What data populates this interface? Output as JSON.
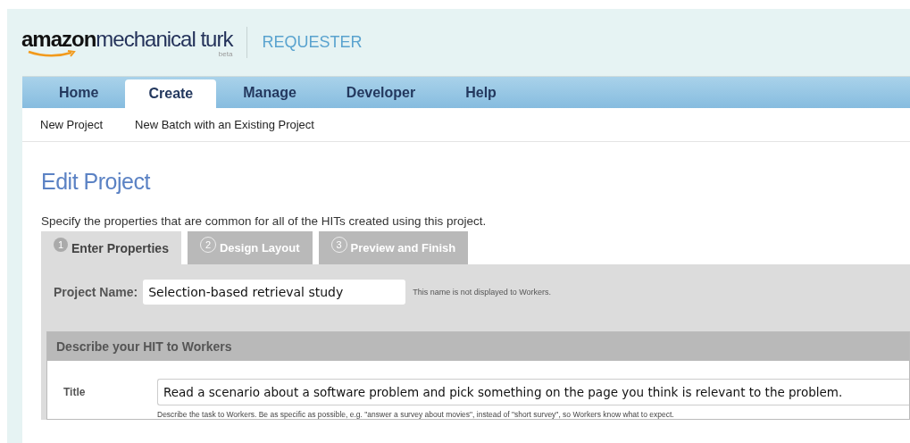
{
  "logo": {
    "brand": "amazon",
    "product": "mechanical turk",
    "tag": "beta"
  },
  "section": "REQUESTER",
  "nav": [
    {
      "label": "Home",
      "selected": false
    },
    {
      "label": "Create",
      "selected": true
    },
    {
      "label": "Manage",
      "selected": false
    },
    {
      "label": "Developer",
      "selected": false
    },
    {
      "label": "Help",
      "selected": false
    }
  ],
  "subnav": [
    "New Project",
    "New Batch with an Existing Project"
  ],
  "page_title": "Edit Project",
  "intro": "Specify the properties that are common for all of the HITs created using this project.",
  "steps": [
    {
      "number": "1",
      "label": "Enter Properties",
      "selected": true
    },
    {
      "number": "2",
      "label": "Design Layout",
      "selected": false
    },
    {
      "number": "3",
      "label": "Preview and Finish",
      "selected": false
    }
  ],
  "project_name": {
    "label": "Project Name:",
    "value": "Selection-based retrieval study",
    "note": "This name is not displayed to Workers."
  },
  "describe": {
    "heading": "Describe your HIT to Workers",
    "fields": [
      {
        "label": "Title",
        "value": "Read a scenario about a software problem and pick something on the page you think is relevant to the problem.",
        "hint": "Describe the task to Workers. Be as specific as possible, e.g. \"answer a survey about movies\", instead of \"short survey\", so Workers know what to expect."
      }
    ]
  }
}
